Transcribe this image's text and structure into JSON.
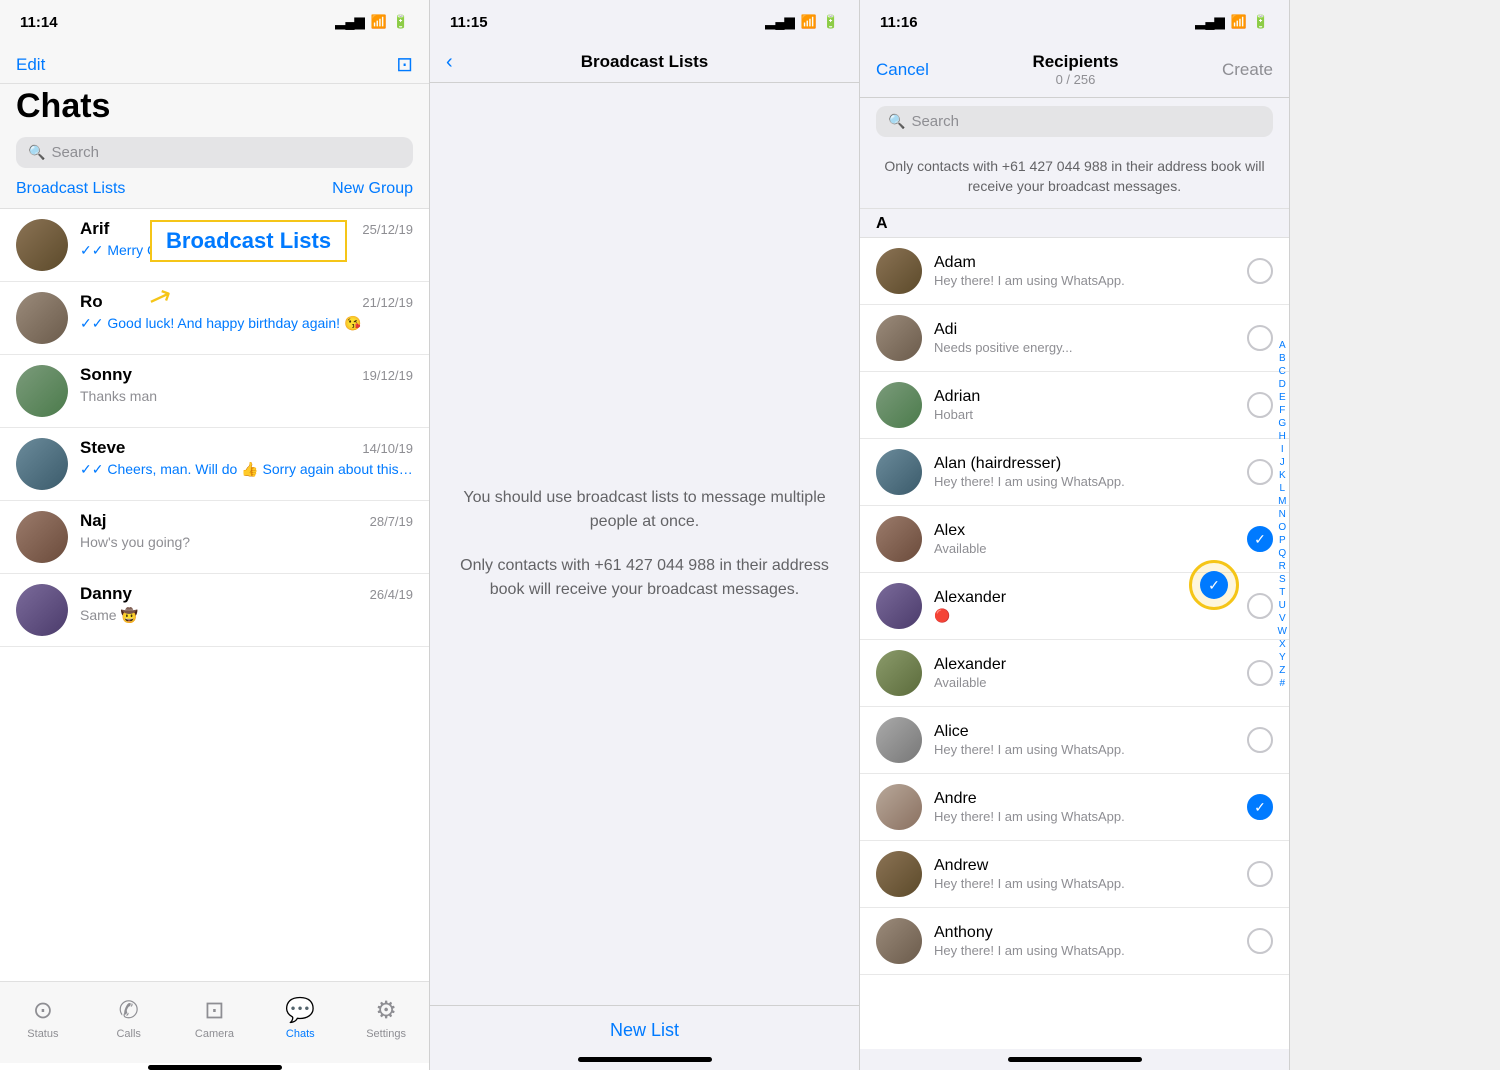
{
  "screen1": {
    "statusBar": {
      "time": "11:14",
      "arrow": "↗"
    },
    "nav": {
      "edit": "Edit"
    },
    "title": "Chats",
    "searchPlaceholder": "Search",
    "links": {
      "broadcastLists": "Broadcast Lists",
      "newGroup": "New Group"
    },
    "broadcastLabel": "Broadcast Lists",
    "chats": [
      {
        "id": 1,
        "name": "Arif",
        "date": "25/12/19",
        "preview": "✓✓ Merry Christmas!",
        "previewBlue": true,
        "avatarClass": "av1"
      },
      {
        "id": 2,
        "name": "Ro",
        "date": "21/12/19",
        "preview": "✓✓ Good luck! And happy birthday again! 😘",
        "previewBlue": true,
        "avatarClass": "av2"
      },
      {
        "id": 3,
        "name": "Sonny",
        "date": "19/12/19",
        "preview": "Thanks man",
        "previewBlue": false,
        "avatarClass": "av3"
      },
      {
        "id": 4,
        "name": "Steve",
        "date": "14/10/19",
        "preview": "✓✓ Cheers, man. Will do 👍 Sorry again about this whole thing. You...",
        "previewBlue": true,
        "avatarClass": "av4"
      },
      {
        "id": 5,
        "name": "Naj",
        "date": "28/7/19",
        "preview": "How's you going?",
        "previewBlue": false,
        "avatarClass": "av5"
      },
      {
        "id": 6,
        "name": "Danny",
        "date": "26/4/19",
        "preview": "Same 🤠",
        "previewBlue": false,
        "avatarClass": "av6"
      }
    ],
    "tabs": [
      {
        "icon": "⊙",
        "label": "Status",
        "active": false
      },
      {
        "icon": "✆",
        "label": "Calls",
        "active": false
      },
      {
        "icon": "⊡",
        "label": "Camera",
        "active": false
      },
      {
        "icon": "💬",
        "label": "Chats",
        "active": true
      },
      {
        "icon": "⚙",
        "label": "Settings",
        "active": false
      }
    ]
  },
  "screen2": {
    "statusBar": {
      "time": "11:15",
      "arrow": "↗"
    },
    "title": "Broadcast Lists",
    "body": "You should use broadcast lists to message multiple people at once.\n\nOnly contacts with +61 427 044 988 in their address book will receive your broadcast messages.",
    "newList": "New List",
    "newListLabel": "New List"
  },
  "screen3": {
    "statusBar": {
      "time": "11:16",
      "arrow": "↗"
    },
    "nav": {
      "cancel": "Cancel",
      "title": "Recipients",
      "count": "0 / 256",
      "create": "Create"
    },
    "searchPlaceholder": "Search",
    "notice": "Only contacts with +61 427 044 988 in their address book will receive your broadcast messages.",
    "sectionHeader": "A",
    "contacts": [
      {
        "name": "Adam",
        "status": "Hey there! I am using WhatsApp.",
        "checked": false,
        "avatarClass": "av1"
      },
      {
        "name": "Adi",
        "status": "Needs positive energy...",
        "checked": false,
        "avatarClass": "av2"
      },
      {
        "name": "Adrian",
        "status": "Hobart",
        "checked": false,
        "avatarClass": "av3"
      },
      {
        "name": "Alan (hairdresser)",
        "status": "Hey there! I am using WhatsApp.",
        "checked": false,
        "avatarClass": "av4"
      },
      {
        "name": "Alex",
        "status": "Available",
        "checked": true,
        "avatarClass": "av5"
      },
      {
        "name": "Alexander",
        "status": "🔴",
        "checked": false,
        "avatarClass": "av6"
      },
      {
        "name": "Alexander",
        "status": "Available",
        "checked": false,
        "avatarClass": "av7"
      },
      {
        "name": "Alice",
        "status": "Hey there! I am using WhatsApp.",
        "checked": false,
        "avatarClass": "av8"
      },
      {
        "name": "Andre",
        "status": "Hey there! I am using WhatsApp.",
        "checked": true,
        "avatarClass": "av9"
      },
      {
        "name": "Andrew",
        "status": "Hey there! I am using WhatsApp.",
        "checked": false,
        "avatarClass": "av1"
      },
      {
        "name": "Anthony",
        "status": "Hey there! I am using WhatsApp.",
        "checked": false,
        "avatarClass": "av2"
      }
    ],
    "alphabet": [
      "A",
      "B",
      "C",
      "D",
      "E",
      "F",
      "G",
      "H",
      "I",
      "J",
      "K",
      "L",
      "M",
      "N",
      "O",
      "P",
      "Q",
      "R",
      "S",
      "T",
      "U",
      "V",
      "W",
      "X",
      "Y",
      "Z",
      "#"
    ]
  }
}
